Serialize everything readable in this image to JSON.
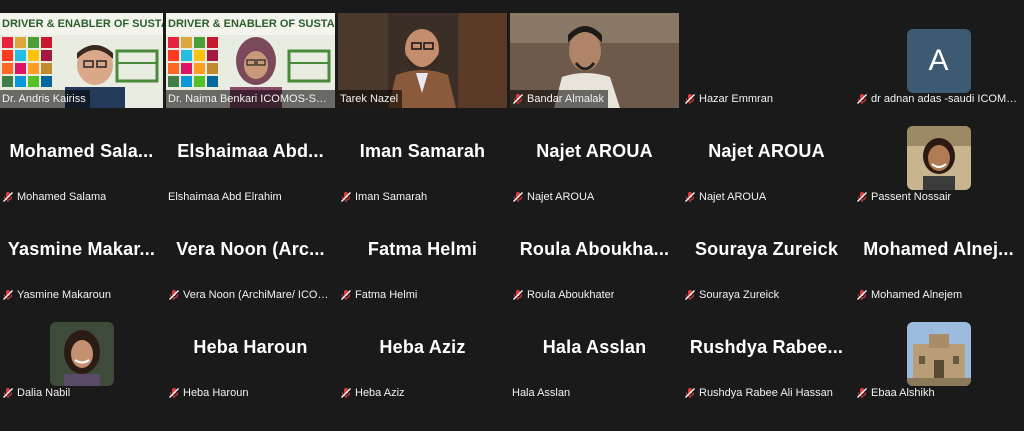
{
  "banner": "DRIVER & ENABLER OF SUSTAINABILITY",
  "participants": [
    {
      "display": "video",
      "name": "Dr. Andris Kairiss",
      "muted": false,
      "active": true
    },
    {
      "display": "video",
      "name": "Dr. Naima Benkari ICOMOS-SDGW...",
      "muted": false,
      "active": false
    },
    {
      "display": "video",
      "name": "Tarek Nazel",
      "muted": false,
      "active": false
    },
    {
      "display": "video",
      "name": "Bandar Almalak",
      "muted": true,
      "active": false
    },
    {
      "display": "blank",
      "name": "Hazar Emmran",
      "muted": true,
      "active": false
    },
    {
      "display": "avatar",
      "initial": "A",
      "name": "dr adnan adas -saudi ICOMOS",
      "muted": true,
      "active": false
    },
    {
      "display": "text",
      "big": "Mohamed  Sala...",
      "name": "Mohamed Salama",
      "muted": true
    },
    {
      "display": "text",
      "big": "Elshaimaa  Abd...",
      "name": "Elshaimaa Abd Elrahim",
      "muted": false
    },
    {
      "display": "text",
      "big": "Iman Samarah",
      "name": "Iman Samarah",
      "muted": true
    },
    {
      "display": "text",
      "big": "Najet AROUA",
      "name": "Najet AROUA",
      "muted": true
    },
    {
      "display": "text",
      "big": "Najet AROUA",
      "name": "Najet AROUA",
      "muted": true
    },
    {
      "display": "photo",
      "name": "Passent Nossair",
      "muted": true,
      "photo": "woman-smiling"
    },
    {
      "display": "text",
      "big": "Yasmine  Makar...",
      "name": "Yasmine Makaroun",
      "muted": true
    },
    {
      "display": "text",
      "big": "Vera  Noon  (Arc...",
      "name": "Vera Noon (ArchiMare/ ICOMO...",
      "muted": true
    },
    {
      "display": "text",
      "big": "Fatma Helmi",
      "name": "Fatma Helmi",
      "muted": true
    },
    {
      "display": "text",
      "big": "Roula  Aboukha...",
      "name": "Roula Aboukhater",
      "muted": true
    },
    {
      "display": "text",
      "big": "Souraya Zureick",
      "name": "Souraya Zureick",
      "muted": true
    },
    {
      "display": "text",
      "big": "Mohamed  Alnej...",
      "name": "Mohamed Alnejem",
      "muted": true
    },
    {
      "display": "photo",
      "name": "Dalia Nabil",
      "muted": true,
      "photo": "woman-portrait"
    },
    {
      "display": "text",
      "big": "Heba Haroun",
      "name": "Heba Haroun",
      "muted": true
    },
    {
      "display": "text",
      "big": "Heba Aziz",
      "name": "Heba Aziz",
      "muted": true
    },
    {
      "display": "text",
      "big": "Hala Asslan",
      "name": "Hala Asslan",
      "muted": false
    },
    {
      "display": "text",
      "big": "Rushdya  Rabee...",
      "name": "Rushdya Rabee Ali Hassan",
      "muted": true
    },
    {
      "display": "photo",
      "name": "Ebaa Alshikh",
      "muted": true,
      "photo": "building"
    }
  ],
  "colors": {
    "muted_icon": "#e23b3b",
    "active_border": "#2bd46a",
    "avatar_bg": "#3d5a73"
  },
  "icons": {
    "mute": "mic-muted-icon"
  }
}
